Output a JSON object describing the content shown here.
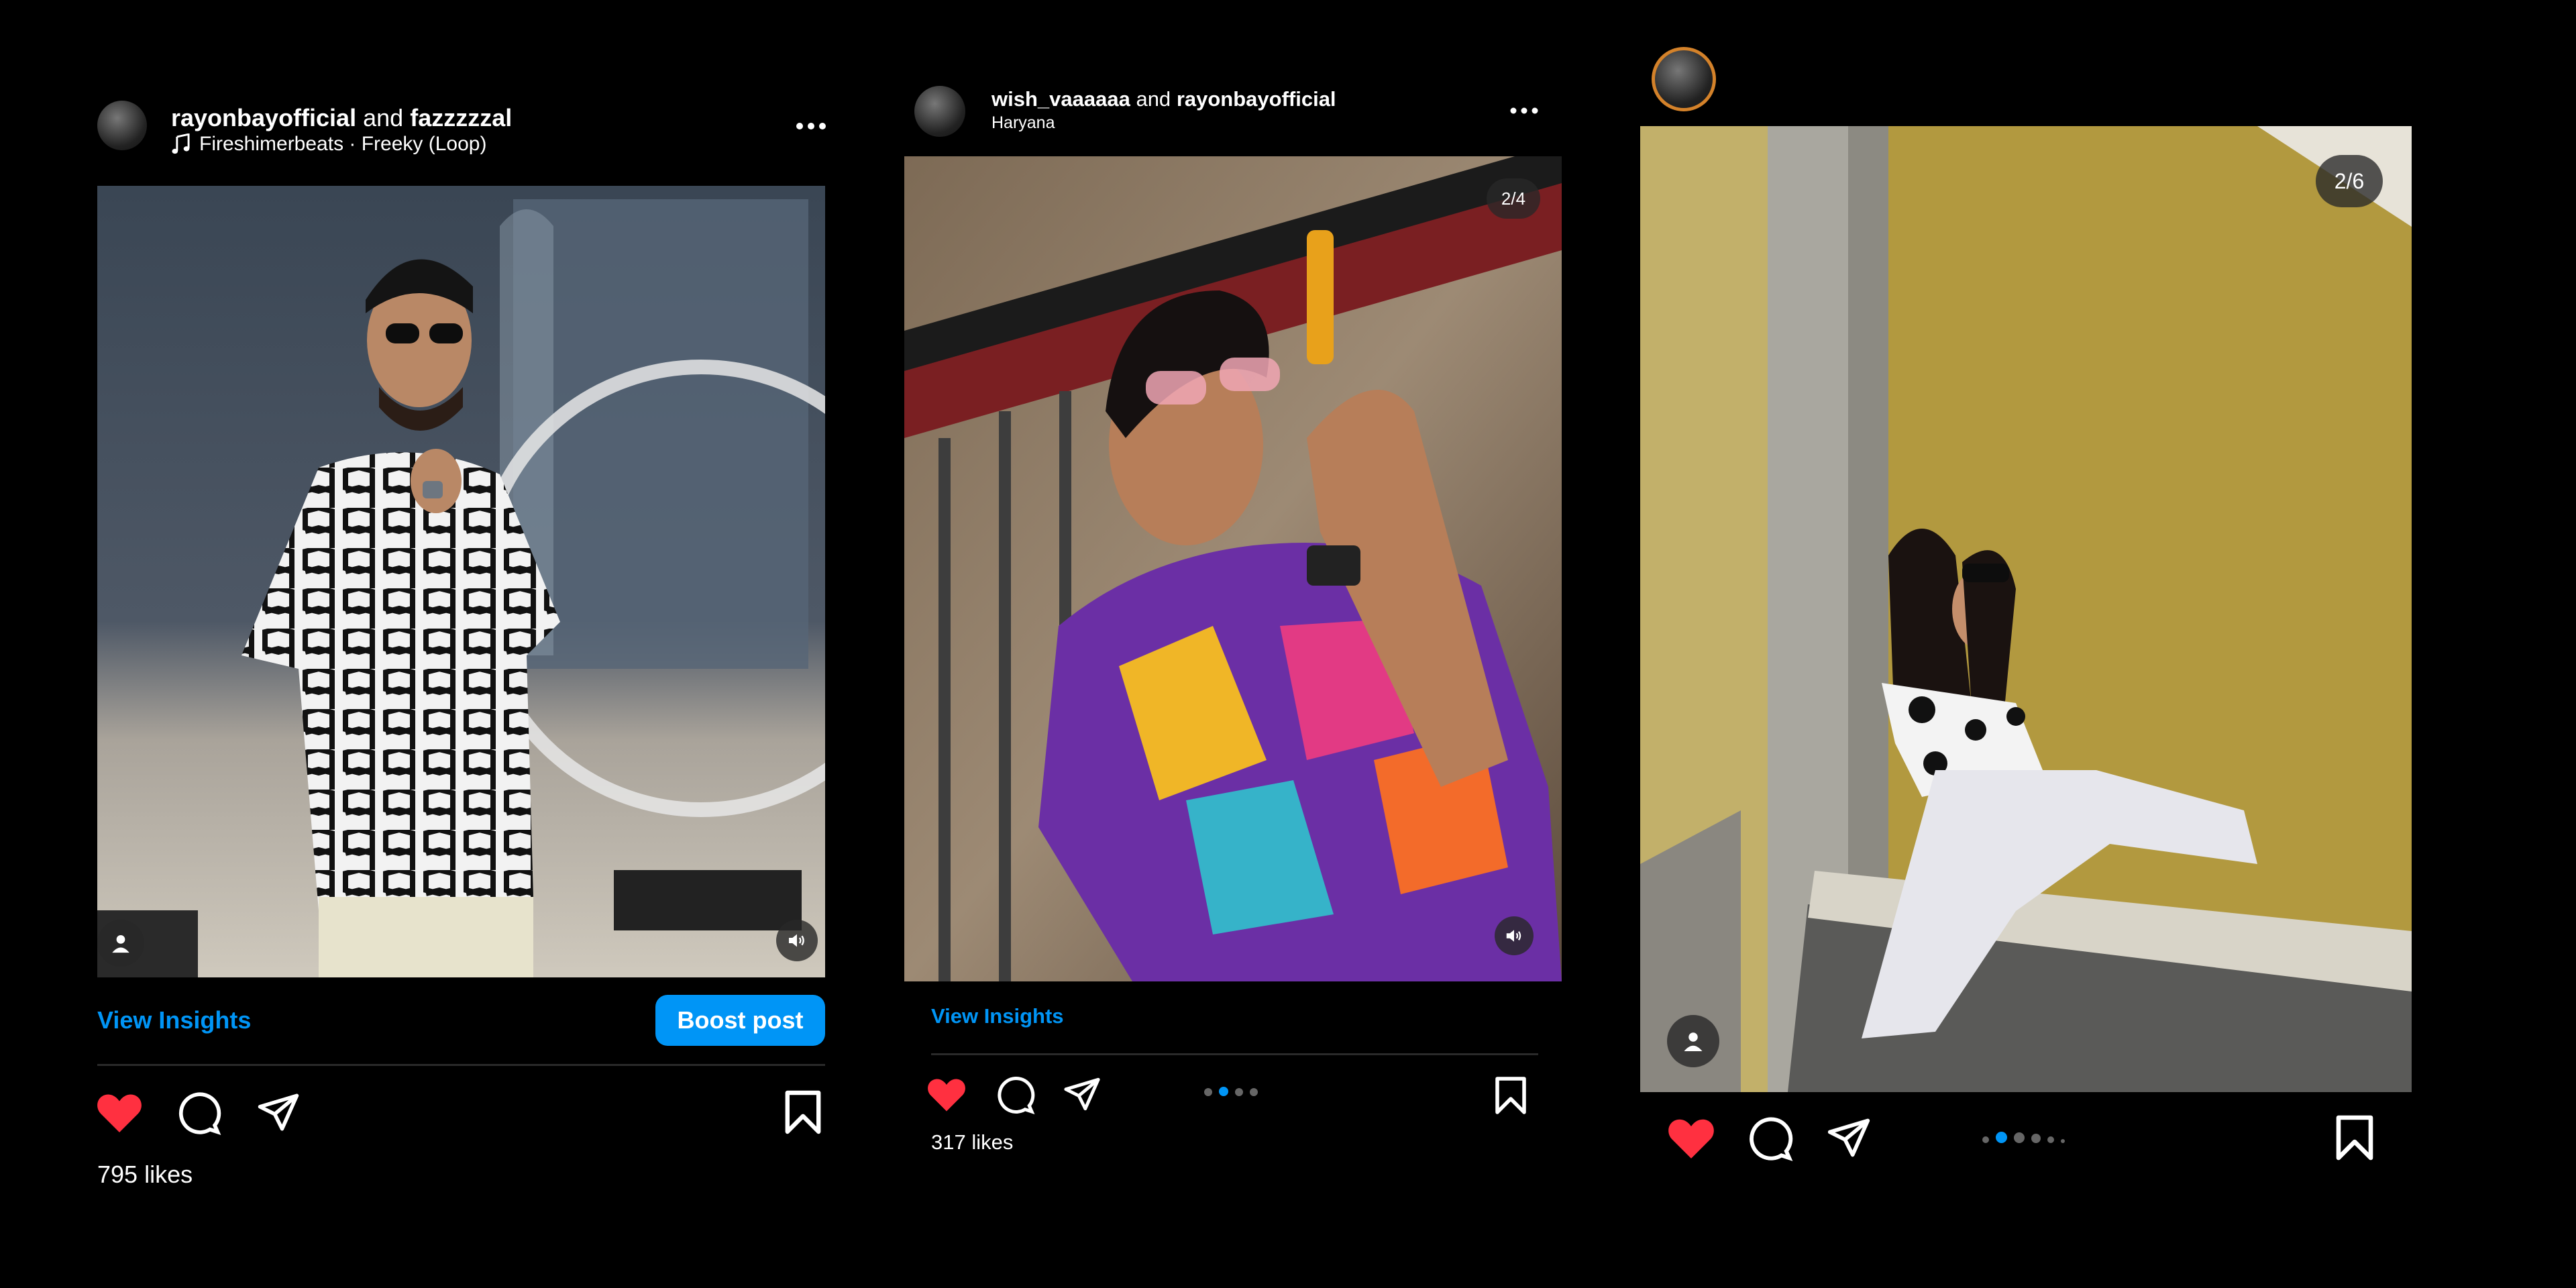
{
  "colors": {
    "accent": "#0095f6",
    "like": "#ff3040",
    "background": "#000000"
  },
  "posts": [
    {
      "user1": "rayonbayofficial",
      "connector": "and",
      "user2": "fazzzzzal",
      "audio": "Fireshimerbeats · Freeky (Loop)",
      "audio_icon": "music-note-icon",
      "more_icon": "more-dots-icon",
      "insights": "View Insights",
      "boost": "Boost post",
      "likes": "795 likes",
      "audio_toggle_icon": "speaker-icon",
      "tag_icon": "person-tag-icon"
    },
    {
      "user1": "wish_vaaaaaa",
      "connector": "and",
      "user2": "rayonbayofficial",
      "location": "Haryana",
      "counter": "2/4",
      "insights": "View Insights",
      "likes": "317 likes",
      "carousel_active_index": 1,
      "carousel_count": 4
    },
    {
      "counter": "2/6",
      "carousel_active_index": 1,
      "carousel_count": 6
    }
  ]
}
